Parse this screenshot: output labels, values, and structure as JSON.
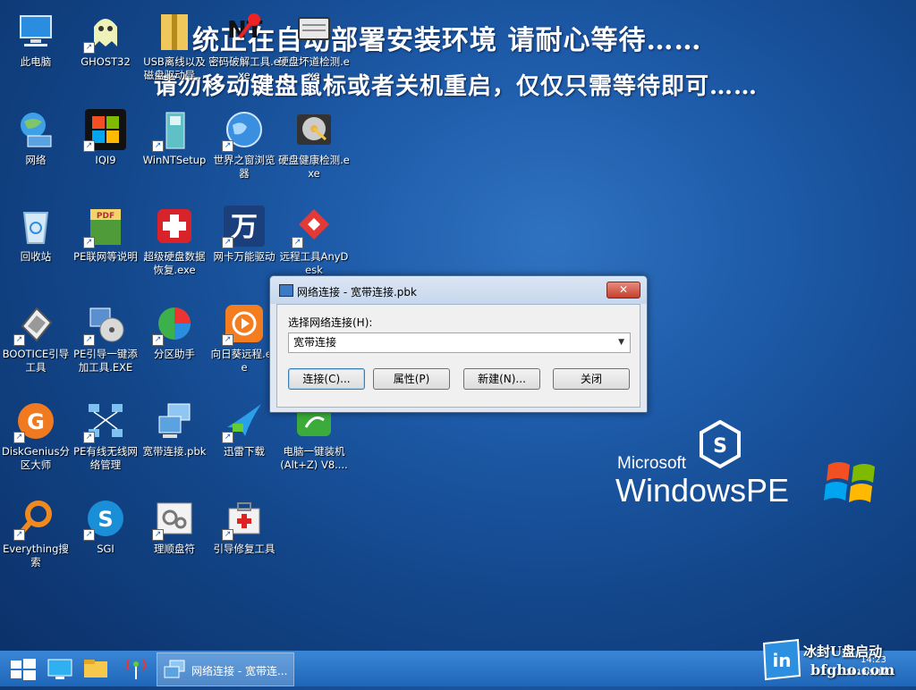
{
  "banner": {
    "line1": "统正在自动部署安装环境 请耐心等待……",
    "line2": "请勿移动键盘鼠标或者关机重启，仅仅只需等待即可……"
  },
  "desktop_icons": [
    {
      "label": "此电脑",
      "icon": "computer-icon"
    },
    {
      "label": "GHOST32",
      "icon": "ghost-icon"
    },
    {
      "label": "USB离线以及磁盘驱动导...",
      "icon": "zip-folder-icon"
    },
    {
      "label": "密码破解工具.exe",
      "icon": "nt-key-icon"
    },
    {
      "label": "硬盘坏道检测.exe",
      "icon": "drive-icon"
    },
    {
      "label": "网络",
      "icon": "network-icon"
    },
    {
      "label": "IQI9",
      "icon": "windows-logo-icon"
    },
    {
      "label": "WinNTSetup",
      "icon": "setup-icon"
    },
    {
      "label": "世界之窗浏览器",
      "icon": "globe-icon"
    },
    {
      "label": "硬盘健康检测.exe",
      "icon": "hdd-health-icon"
    },
    {
      "label": "回收站",
      "icon": "recycle-bin-icon"
    },
    {
      "label": "PE联网等说明",
      "icon": "pdf-icon"
    },
    {
      "label": "超级硬盘数据恢复.exe",
      "icon": "red-cross-icon"
    },
    {
      "label": "网卡万能驱动",
      "icon": "wan-icon"
    },
    {
      "label": "远程工具AnyDesk",
      "icon": "anydesk-icon"
    },
    {
      "label": "BOOTICE引导工具",
      "icon": "bootice-icon"
    },
    {
      "label": "PE引导一键添加工具.EXE",
      "icon": "disc-tool-icon"
    },
    {
      "label": "分区助手",
      "icon": "partition-icon"
    },
    {
      "label": "向日葵远程.exe",
      "icon": "sunflower-icon"
    },
    {
      "label": "DiskGenius分区大师",
      "icon": "diskgenius-icon"
    },
    {
      "label": "PE有线无线网络管理",
      "icon": "network-tree-icon"
    },
    {
      "label": "宽带连接.pbk",
      "icon": "broadband-icon"
    },
    {
      "label": "迅雷下载",
      "icon": "thunder-icon"
    },
    {
      "label": "电脑一键装机(Alt+Z) V8....",
      "icon": "installer-icon"
    },
    {
      "label": "Everything搜索",
      "icon": "magnifier-icon"
    },
    {
      "label": "SGI",
      "icon": "sgi-icon"
    },
    {
      "label": "理顺盘符",
      "icon": "gears-icon"
    },
    {
      "label": "引导修复工具",
      "icon": "repair-kit-icon"
    }
  ],
  "dialog": {
    "title": "网络连接 - 宽带连接.pbk",
    "close_label": "✕",
    "select_label": "选择网络连接(H):",
    "select_value": "宽带连接",
    "buttons": [
      "连接(C)...",
      "属性(P)",
      "新建(N)...",
      "关闭"
    ]
  },
  "logo": {
    "microsoft": "Microsoft",
    "windowspe": "WindowsPE"
  },
  "taskbar": {
    "task_label": "网络连接 - 宽带连...",
    "clock": "14:23",
    "date": "2018/5/17"
  },
  "watermark": {
    "top": "冰封U盘启动",
    "bottom": "bfgho.com"
  },
  "colors": {
    "desktop": "#1d5aa8",
    "taskbar": "#2a74c8",
    "dialog_close": "#c4402d"
  }
}
